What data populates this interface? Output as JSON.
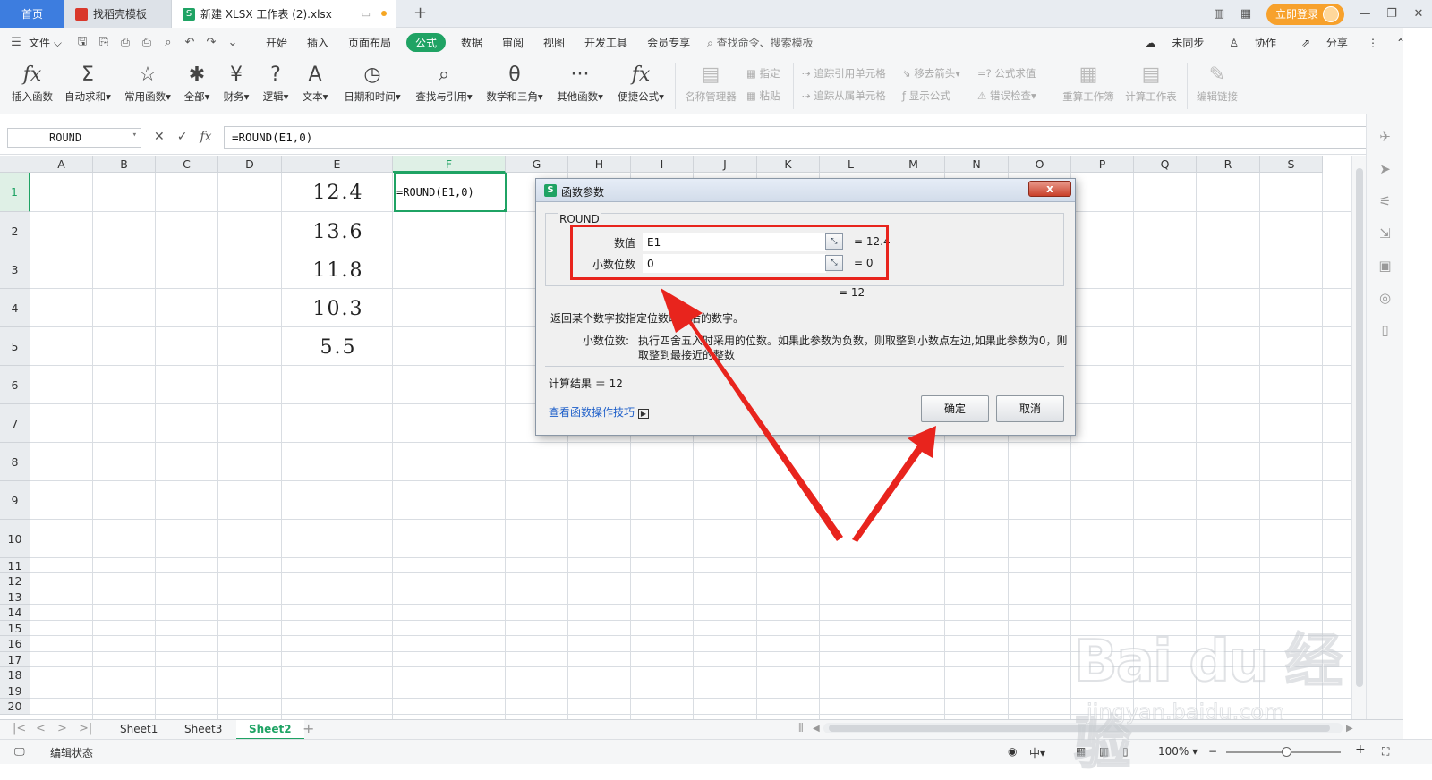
{
  "titlebar": {
    "tabs": [
      {
        "label": "首页"
      },
      {
        "label": "找稻壳模板"
      },
      {
        "label": "新建 XLSX 工作表 (2).xlsx"
      }
    ],
    "login_label": "立即登录"
  },
  "menubar": {
    "file_label": "文件",
    "items": [
      "开始",
      "插入",
      "页面布局",
      "公式",
      "数据",
      "审阅",
      "视图",
      "开发工具",
      "会员专享"
    ],
    "search_placeholder": "查找命令、搜索模板",
    "right": [
      "未同步",
      "协作",
      "分享"
    ]
  },
  "ribbon": {
    "buttons": [
      {
        "label": "插入函数",
        "icon": "fx"
      },
      {
        "label": "自动求和▾",
        "icon": "Σ"
      },
      {
        "label": "常用函数▾",
        "icon": "☆"
      },
      {
        "label": "全部▾",
        "icon": "✱"
      },
      {
        "label": "财务▾",
        "icon": "¥"
      },
      {
        "label": "逻辑▾",
        "icon": "?"
      },
      {
        "label": "文本▾",
        "icon": "A"
      },
      {
        "label": "日期和时间▾",
        "icon": "◷"
      },
      {
        "label": "查找与引用▾",
        "icon": "⌕"
      },
      {
        "label": "数学和三角▾",
        "icon": "θ"
      },
      {
        "label": "其他函数▾",
        "icon": "···"
      },
      {
        "label": "便捷公式▾",
        "icon": "fx"
      }
    ],
    "name_manager": "名称管理器",
    "specify": "指定",
    "paste": "粘贴",
    "trace_precedents": "追踪引用单元格",
    "trace_dependents": "追踪从属单元格",
    "remove_arrows": "移去箭头▾",
    "show_formulas": "显示公式",
    "eval_formula": "公式求值",
    "error_check": "错误检查▾",
    "recalc_workbook": "重算工作簿",
    "calc_sheet": "计算工作表",
    "edit_links": "编辑链接"
  },
  "formula_bar": {
    "name_box": "ROUND",
    "formula": "=ROUND(E1,0)"
  },
  "grid": {
    "columns": [
      "A",
      "B",
      "C",
      "D",
      "E",
      "F",
      "G",
      "H",
      "I",
      "J",
      "K",
      "L",
      "M",
      "N",
      "O",
      "P",
      "Q",
      "R",
      "S"
    ],
    "rows": [
      "1",
      "2",
      "3",
      "4",
      "5",
      "6",
      "7",
      "8",
      "9",
      "10",
      "11",
      "12",
      "13",
      "14",
      "15",
      "16",
      "17",
      "18",
      "19",
      "20"
    ],
    "e_values": [
      "12.4",
      "13.6",
      "11.8",
      "10.3",
      "5.5"
    ],
    "f1_text": "=ROUND(E1,0)"
  },
  "sheets": {
    "tabs": [
      "Sheet1",
      "Sheet3",
      "Sheet2"
    ],
    "active": "Sheet2"
  },
  "status": {
    "mode": "编辑状态",
    "zoom": "100%"
  },
  "dialog": {
    "title": "函数参数",
    "function_name": "ROUND",
    "args": [
      {
        "label": "数值",
        "value": "E1",
        "result": "= 12.4"
      },
      {
        "label": "小数位数",
        "value": "0",
        "result": "= 0"
      }
    ],
    "overall_result": "= 12",
    "description": "返回某个数字按指定位数取整后的数字。",
    "param_label": "小数位数:",
    "param_desc_1": "执行四舍五入时采用的位数。如果此参数为负数，则取整到小数点左边,如果此参数为0，则",
    "param_desc_2": "取整到最接近的整数",
    "calc_result": "计算结果 ＝ 12",
    "tips_link": "查看函数操作技巧",
    "ok_label": "确定",
    "cancel_label": "取消",
    "close_label": "x"
  },
  "watermark": {
    "brand": "Bai du 经验",
    "url": "jingyan.baidu.com"
  },
  "colors": {
    "accent_green": "#1fa364",
    "tab_blue": "#3d7ddf",
    "annotation_red": "#e8241d",
    "login_orange": "#f7a12c"
  }
}
